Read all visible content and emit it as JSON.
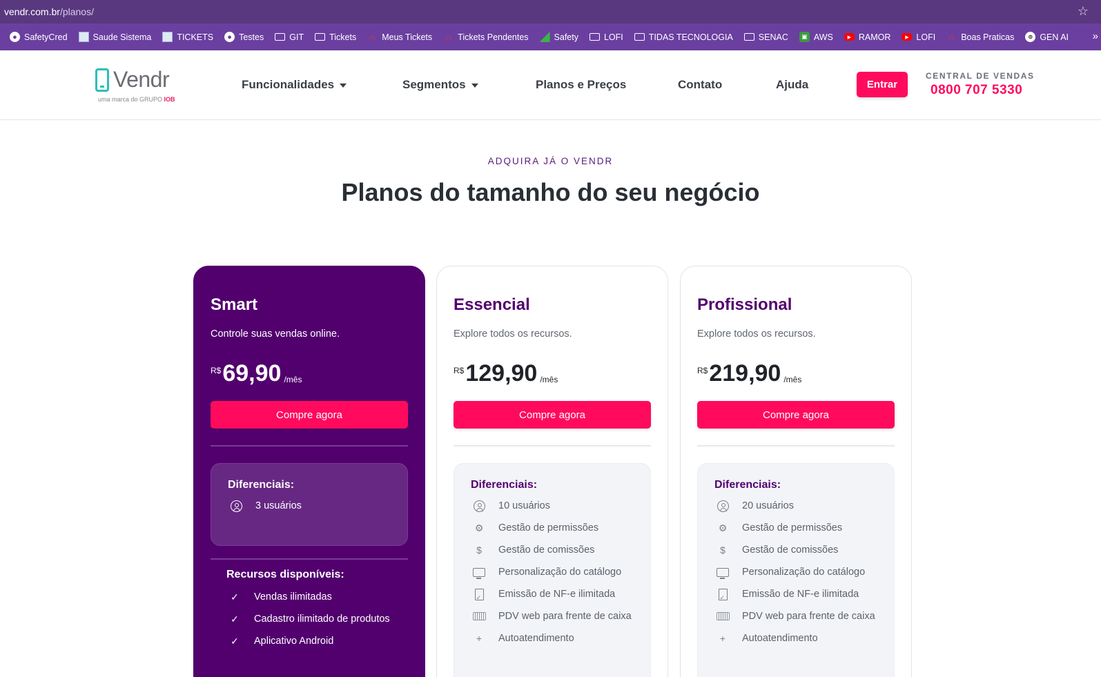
{
  "browser": {
    "url_host": "vendr.com.br",
    "url_path": "/planos/",
    "bookmarks": [
      {
        "label": "SafetyCred",
        "icon": "globe-icon"
      },
      {
        "label": "Saude Sistema",
        "icon": "page-icon"
      },
      {
        "label": "TICKETS",
        "icon": "page-icon"
      },
      {
        "label": "Testes",
        "icon": "globe-icon"
      },
      {
        "label": "GIT",
        "icon": "folder-icon"
      },
      {
        "label": "Tickets",
        "icon": "folder-icon"
      },
      {
        "label": "Meus Tickets",
        "icon": "headset-icon"
      },
      {
        "label": "Tickets Pendentes",
        "icon": "headset-icon"
      },
      {
        "label": "Safety",
        "icon": "chart-icon"
      },
      {
        "label": "LOFI",
        "icon": "folder-icon"
      },
      {
        "label": "TIDAS TECNOLOGIA",
        "icon": "folder-icon"
      },
      {
        "label": "SENAC",
        "icon": "folder-icon"
      },
      {
        "label": "AWS",
        "icon": "aws-icon"
      },
      {
        "label": "RAMOR",
        "icon": "youtube-icon"
      },
      {
        "label": "LOFI",
        "icon": "youtube-icon"
      },
      {
        "label": "Boas Praticas",
        "icon": "headset-icon"
      },
      {
        "label": "GEN AI",
        "icon": "openai-icon"
      }
    ]
  },
  "header": {
    "logo_word": "Vendr",
    "logo_sub_prefix": "uma marca do GRUPO ",
    "logo_sub_brand": "IOB",
    "nav": {
      "funcionalidades": "Funcionalidades",
      "segmentos": "Segmentos",
      "planos": "Planos e Preços",
      "contato": "Contato",
      "ajuda": "Ajuda"
    },
    "login_button": "Entrar",
    "central_label": "CENTRAL DE VENDAS",
    "central_phone": "0800 707 5330"
  },
  "hero": {
    "eyebrow": "ADQUIRA JÁ O VENDR",
    "headline": "Planos do tamanho do seu negócio"
  },
  "colors": {
    "primary_purple": "#52006e",
    "accent_pink": "#ff0a5d",
    "browser_bar": "#6b3fa0"
  },
  "plans": [
    {
      "name": "Smart",
      "description": "Controle suas vendas online.",
      "currency": "R$",
      "price": "69,90",
      "period": "/mês",
      "cta": "Compre agora",
      "diff_title": "Diferenciais:",
      "diffs": [
        {
          "icon": "user-icon",
          "label": "3 usuários"
        }
      ],
      "resources_title": "Recursos disponíveis:",
      "resources": [
        "Vendas ilimitadas",
        "Cadastro ilimitado de produtos",
        "Aplicativo Android"
      ]
    },
    {
      "name": "Essencial",
      "description": "Explore todos os recursos.",
      "currency": "R$",
      "price": "129,90",
      "period": "/mês",
      "cta": "Compre agora",
      "diff_title": "Diferenciais:",
      "diffs": [
        {
          "icon": "user-icon",
          "label": "10 usuários"
        },
        {
          "icon": "gear-icon",
          "label": "Gestão de permissões"
        },
        {
          "icon": "dollar-icon",
          "label": "Gestão de comissões"
        },
        {
          "icon": "monitor-icon",
          "label": "Personalização do catálogo"
        },
        {
          "icon": "document-icon",
          "label": "Emissão de NF-e ilimitada"
        },
        {
          "icon": "keyboard-icon",
          "label": "PDV web para frente de caixa"
        },
        {
          "icon": "plus-icon",
          "label": "Autoatendimento"
        }
      ]
    },
    {
      "name": "Profissional",
      "description": "Explore todos os recursos.",
      "currency": "R$",
      "price": "219,90",
      "period": "/mês",
      "cta": "Compre agora",
      "diff_title": "Diferenciais:",
      "diffs": [
        {
          "icon": "user-icon",
          "label": "20 usuários"
        },
        {
          "icon": "gear-icon",
          "label": "Gestão de permissões"
        },
        {
          "icon": "dollar-icon",
          "label": "Gestão de comissões"
        },
        {
          "icon": "monitor-icon",
          "label": "Personalização do catálogo"
        },
        {
          "icon": "document-icon",
          "label": "Emissão de NF-e ilimitada"
        },
        {
          "icon": "keyboard-icon",
          "label": "PDV web para frente de caixa"
        },
        {
          "icon": "plus-icon",
          "label": "Autoatendimento"
        }
      ]
    }
  ]
}
